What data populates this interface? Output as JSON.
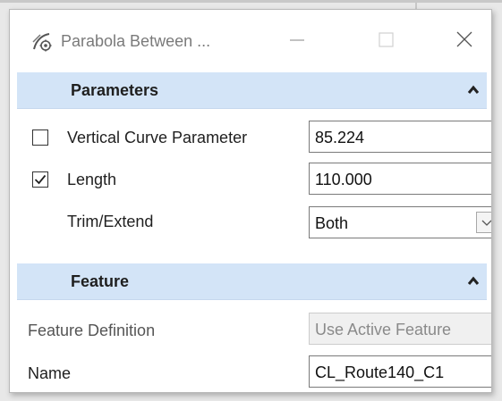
{
  "window": {
    "title": "Parabola Between ...",
    "app_icon": "parabola-tool-icon"
  },
  "window_controls": [
    {
      "name": "minimize-icon"
    },
    {
      "name": "maximize-icon"
    },
    {
      "name": "close-icon"
    }
  ],
  "parameters": {
    "header": "Parameters",
    "collapse_icon": "chevron-up-icon",
    "vertical_curve": {
      "label": "Vertical Curve Parameter",
      "value": "85.224",
      "checked": false
    },
    "length": {
      "label": "Length",
      "value": "110.000",
      "checked": true
    },
    "trim_extend": {
      "label": "Trim/Extend",
      "value": "Both",
      "dropdown_icon": "chevron-down-icon"
    }
  },
  "feature": {
    "header": "Feature",
    "collapse_icon": "chevron-up-icon",
    "feature_definition": {
      "label": "Feature Definition",
      "value": "Use Active Feature",
      "enabled": false
    },
    "name": {
      "label": "Name",
      "value": "CL_Route140_C1"
    }
  },
  "colors": {
    "header_bg": "#d3e4f7",
    "window_bg": "#ffffff",
    "disabled_field_bg": "#f0f0f0"
  }
}
